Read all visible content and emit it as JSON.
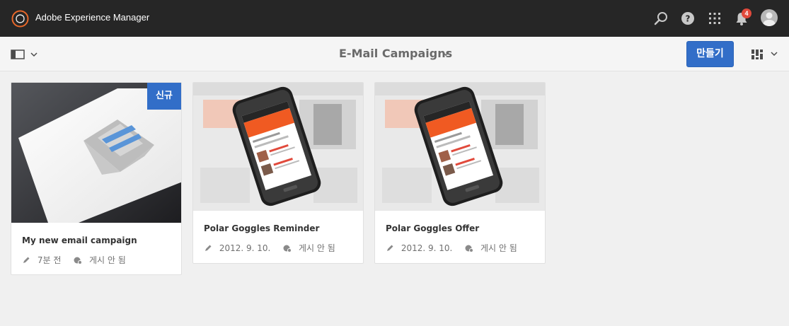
{
  "header": {
    "app_title": "Adobe Experience Manager",
    "notification_count": "4",
    "icons": [
      "adobe-logo-icon",
      "search-icon",
      "help-icon",
      "apps-grid-icon",
      "bell-icon",
      "user-avatar-icon"
    ]
  },
  "toolbar": {
    "page_title": "E-Mail Campaigns",
    "create_label": "만들기"
  },
  "cards": [
    {
      "title": "My new email campaign",
      "modified": "7분 전",
      "status": "게시 안 됨",
      "badge": "신규"
    },
    {
      "title": "Polar Goggles Reminder",
      "modified": "2012. 9. 10.",
      "status": "게시 안 됨"
    },
    {
      "title": "Polar Goggles Offer",
      "modified": "2012. 9. 10.",
      "status": "게시 안 됨"
    }
  ],
  "colors": {
    "header_bg": "#262626",
    "accent": "#326ec8",
    "page_bg": "#f0f0f0",
    "notification": "#e14a3c"
  }
}
